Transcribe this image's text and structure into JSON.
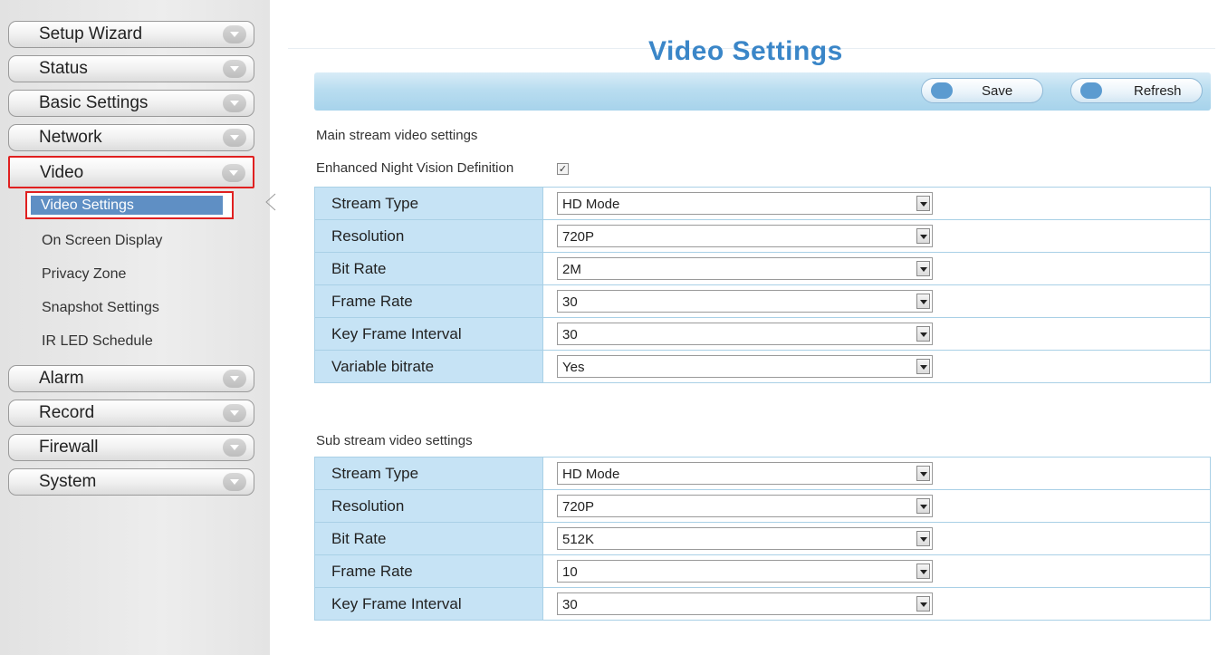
{
  "sidebar": {
    "nav_top": [
      "Setup Wizard",
      "Status",
      "Basic Settings",
      "Network"
    ],
    "video_label": "Video",
    "active_sub": "Video Settings",
    "sub_items": [
      "On Screen Display",
      "Privacy Zone",
      "Snapshot Settings",
      "IR LED Schedule"
    ],
    "nav_bottom": [
      "Alarm",
      "Record",
      "Firewall",
      "System"
    ]
  },
  "header": {
    "title": "Video Settings",
    "save_label": "Save",
    "refresh_label": "Refresh"
  },
  "main_stream": {
    "section_label": "Main stream video settings",
    "night_vision_label": "Enhanced Night Vision Definition",
    "night_vision_checked": true,
    "rows": [
      {
        "label": "Stream Type",
        "value": "HD Mode"
      },
      {
        "label": "Resolution",
        "value": "720P"
      },
      {
        "label": "Bit Rate",
        "value": "2M"
      },
      {
        "label": "Frame Rate",
        "value": "30"
      },
      {
        "label": "Key Frame Interval",
        "value": "30"
      },
      {
        "label": "Variable bitrate",
        "value": "Yes"
      }
    ]
  },
  "sub_stream": {
    "section_label": "Sub stream video settings",
    "rows": [
      {
        "label": "Stream Type",
        "value": "HD Mode"
      },
      {
        "label": "Resolution",
        "value": "720P"
      },
      {
        "label": "Bit Rate",
        "value": "512K"
      },
      {
        "label": "Frame Rate",
        "value": "10"
      },
      {
        "label": "Key Frame Interval",
        "value": "30"
      }
    ]
  },
  "colors": {
    "title_blue": "#3a86c8",
    "highlight_red": "#e02020",
    "active_sub_bg": "#5f8fc4",
    "label_cell_bg": "#c6e3f5"
  }
}
